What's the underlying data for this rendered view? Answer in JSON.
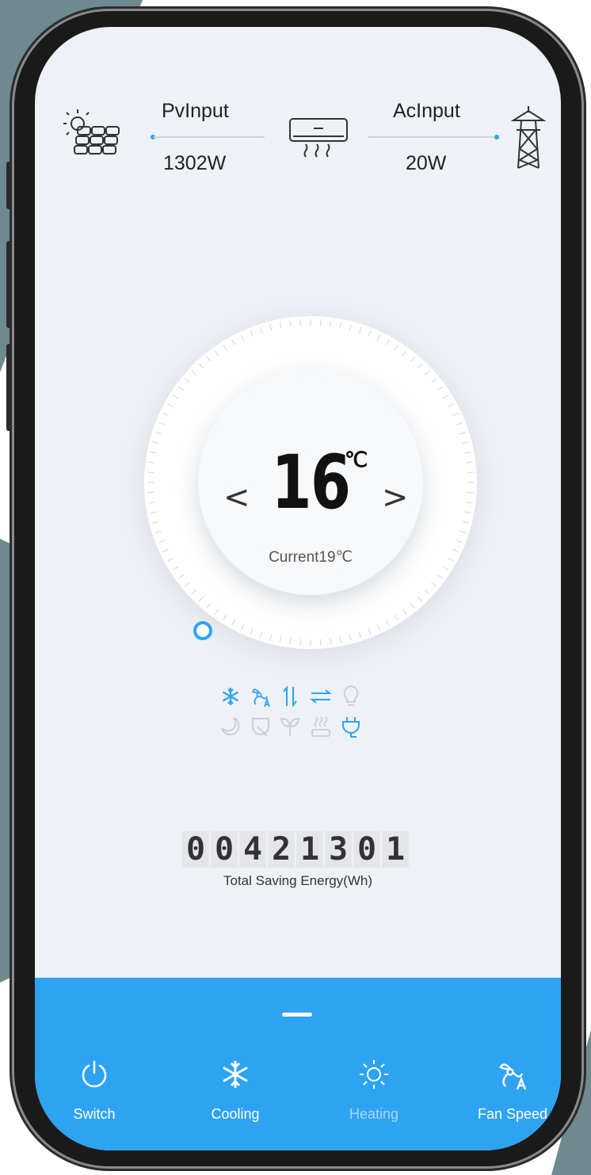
{
  "colors": {
    "accent": "#2ea3f2",
    "panel": "#2ea3f2",
    "screen_bg": "#eef1f5"
  },
  "top": {
    "pv": {
      "label": "PvInput",
      "value": "1302W",
      "icon": "solar-panel-icon"
    },
    "ac": {
      "label": "AcInput",
      "value": "20W",
      "icon": "power-tower-icon"
    },
    "center_icon": "air-conditioner-icon"
  },
  "thermostat": {
    "set_temp": "16",
    "unit": "℃",
    "prev": "<",
    "next": ">",
    "current": "Current19℃"
  },
  "status_icons": [
    {
      "name": "cooling-mode-icon",
      "active": true
    },
    {
      "name": "fan-auto-icon",
      "active": true
    },
    {
      "name": "swing-vertical-icon",
      "active": true
    },
    {
      "name": "swing-horizontal-icon",
      "active": true
    },
    {
      "name": "light-icon",
      "active": false
    },
    {
      "name": "sleep-icon",
      "active": false
    },
    {
      "name": "eco-leaf-icon",
      "active": false
    },
    {
      "name": "plant-icon",
      "active": false
    },
    {
      "name": "heat-icon",
      "active": false
    },
    {
      "name": "plug-icon",
      "active": true
    }
  ],
  "energy": {
    "digits": [
      "0",
      "0",
      "4",
      "2",
      "1",
      "3",
      "0",
      "1"
    ],
    "label": "Total Saving Energy(Wh)"
  },
  "nav": [
    {
      "label": "Switch",
      "icon": "power-icon",
      "active": true
    },
    {
      "label": "Cooling",
      "icon": "snowflake-icon",
      "active": true
    },
    {
      "label": "Heating",
      "icon": "sun-icon",
      "active": false
    },
    {
      "label": "Fan Speed",
      "icon": "fan-auto-icon",
      "active": true
    }
  ]
}
